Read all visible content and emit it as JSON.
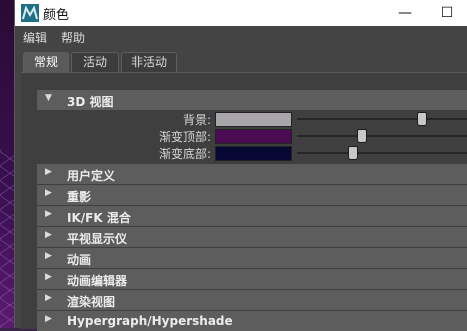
{
  "window": {
    "title": "颜色"
  },
  "menu": [
    "编辑",
    "帮助"
  ],
  "tabs": [
    "常规",
    "活动",
    "非活动"
  ],
  "active_tab": "常规",
  "expanded_section": {
    "label": "3D 视图",
    "rows": [
      {
        "label": "背景:",
        "color": "#a8a6ab",
        "slider": 0.7
      },
      {
        "label": "渐变顶部:",
        "color": "#4a0b53",
        "slider": 0.36
      },
      {
        "label": "渐变底部:",
        "color": "#060733",
        "slider": 0.31
      }
    ]
  },
  "sections": [
    "用户定义",
    "重影",
    "IK/FK 混合",
    "平视显示仪",
    "动画",
    "动画编辑器",
    "渲染视图",
    "Hypergraph/Hypershade"
  ],
  "icons": {
    "app": "maya-icon",
    "minimize": "minimize-icon",
    "maximize": "maximize-icon"
  }
}
